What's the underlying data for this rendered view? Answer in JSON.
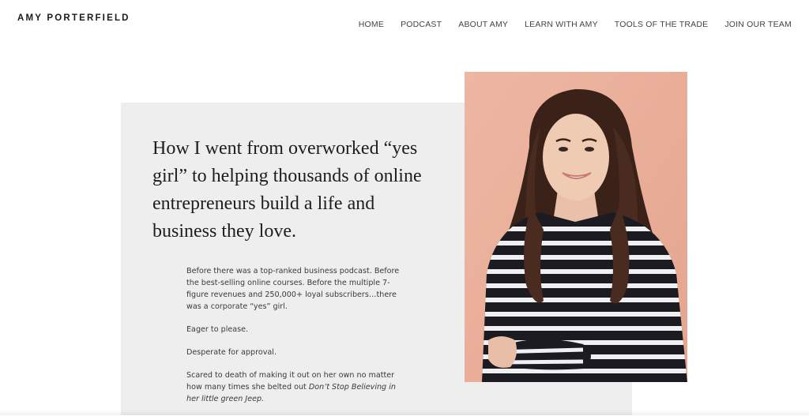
{
  "header": {
    "logo": "AMY PORTERFIELD",
    "nav": [
      {
        "label": "HOME"
      },
      {
        "label": "PODCAST"
      },
      {
        "label": "ABOUT AMY"
      },
      {
        "label": "LEARN WITH AMY"
      },
      {
        "label": "TOOLS OF THE TRADE"
      },
      {
        "label": "JOIN OUR TEAM"
      }
    ]
  },
  "hero": {
    "headline": "How I went from overworked “yes girl” to helping thousands of online entrepreneurs build a life and business they love.",
    "paragraphs": [
      "Before there was a top-ranked business podcast. Before the best-selling online courses. Before the multiple 7-figure revenues and 250,000+ loyal subscribers…there was a corporate “yes” girl.",
      "Eager to please.",
      "Desperate for approval."
    ],
    "last_paragraph_lead": "Scared to death of making it out on her own no matter how many times she belted out ",
    "last_paragraph_italic": "Don’t Stop Believing in her little green Jeep."
  },
  "colors": {
    "panel": "#eeeeee",
    "photo_background": "#e8ad98",
    "text": "#1a1a1a",
    "nav_text": "#444444"
  }
}
